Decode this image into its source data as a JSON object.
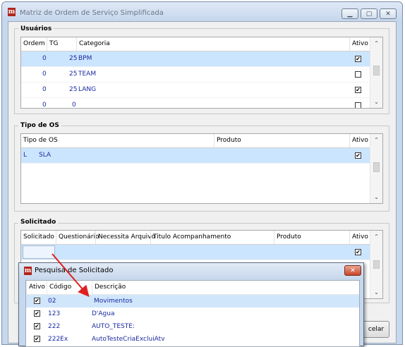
{
  "window": {
    "title": "Matriz de Ordem de Serviço Simplificada",
    "app_icon_letter": "m"
  },
  "usuarios": {
    "group_label": "Usuários",
    "columns": [
      "Ordem",
      "TG",
      "Categoria",
      "Ativo"
    ],
    "rows": [
      {
        "ordem": "0",
        "tg": "25",
        "categoria": "BPM",
        "ativo": true,
        "selected": true
      },
      {
        "ordem": "0",
        "tg": "25",
        "categoria": "TEAM",
        "ativo": false,
        "selected": false
      },
      {
        "ordem": "0",
        "tg": "25",
        "categoria": "LANG",
        "ativo": true,
        "selected": false
      },
      {
        "ordem": "0",
        "tg": "0",
        "categoria": "",
        "ativo": false,
        "selected": false
      }
    ]
  },
  "tipo_os": {
    "group_label": "Tipo de OS",
    "columns": [
      "Tipo de OS",
      "Produto",
      "Ativo"
    ],
    "rows": [
      {
        "tipo": "L",
        "descricao": "SLA",
        "produto": "",
        "ativo": true,
        "selected": true
      }
    ]
  },
  "solicitado": {
    "group_label": "Solicitado",
    "columns": [
      "Solicitado",
      "Questionário",
      "Necessita Arquivo",
      "Titulo Acompanhamento",
      "Produto",
      "Ativo"
    ],
    "rows": [
      {
        "ativo": true,
        "selected": true
      }
    ]
  },
  "buttons": {
    "cancel_partial": "celar"
  },
  "popup": {
    "title": "Pesquisa de Solicitado",
    "columns": [
      "Ativo",
      "Código",
      "Descrição"
    ],
    "rows": [
      {
        "ativo": true,
        "codigo": "02",
        "descricao": "Movimentos",
        "selected": true
      },
      {
        "ativo": true,
        "codigo": "123",
        "descricao": "D'Agua",
        "selected": false
      },
      {
        "ativo": true,
        "codigo": "222",
        "descricao": "AUTO_TESTE:",
        "selected": false
      },
      {
        "ativo": true,
        "codigo": "222Ex",
        "descricao": "AutoTesteCriaExcluiAtv",
        "selected": false
      }
    ]
  },
  "colors": {
    "selection": "#cce5ff",
    "annotation_arrow": "#e02020",
    "cell_text": "#1a2aa0"
  },
  "icons": {
    "check": "✔",
    "scroll_up": "⌃",
    "scroll_down": "⌄"
  }
}
